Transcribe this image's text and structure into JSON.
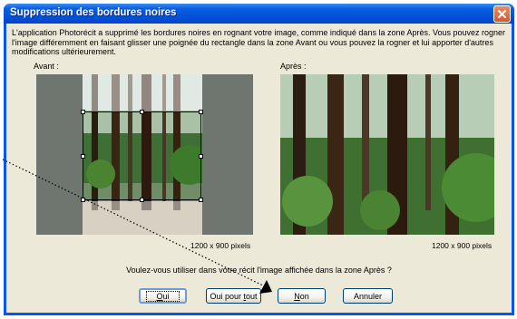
{
  "window": {
    "title": "Suppression des bordures noires"
  },
  "intro_text": "L'application Photorécit a supprimé les bordures noires en rognant votre image, comme indiqué dans la zone Après. Vous pouvez rogner l'image différemment en faisant glisser une poignée du rectangle dans la zone Avant ou vous pouvez la rogner et lui apporter d'autres modifications ultérieurement.",
  "before": {
    "label": "Avant :",
    "size": "1200 x 900 pixels"
  },
  "after": {
    "label": "Après :",
    "size": "1200 x 900 pixels"
  },
  "question": "Voulez-vous utiliser dans votre récit l'image affichée dans la zone Après ?",
  "buttons": {
    "oui": {
      "pre": "",
      "mnemonic": "O",
      "post": "ui"
    },
    "oui_pour_tout": {
      "pre": "Oui pour ",
      "mnemonic": "t",
      "post": "out"
    },
    "non": {
      "pre": "",
      "mnemonic": "N",
      "post": "on"
    },
    "annuler": {
      "label": "Annuler"
    }
  },
  "icons": {
    "close": "close-icon",
    "pointer": "arrow-pointer-icon"
  },
  "colors": {
    "titlebar": "#0a55e4",
    "dialog_bg": "#ece9d8",
    "close_button": "#d35a2c",
    "before_border_gray": "#6f7670"
  }
}
